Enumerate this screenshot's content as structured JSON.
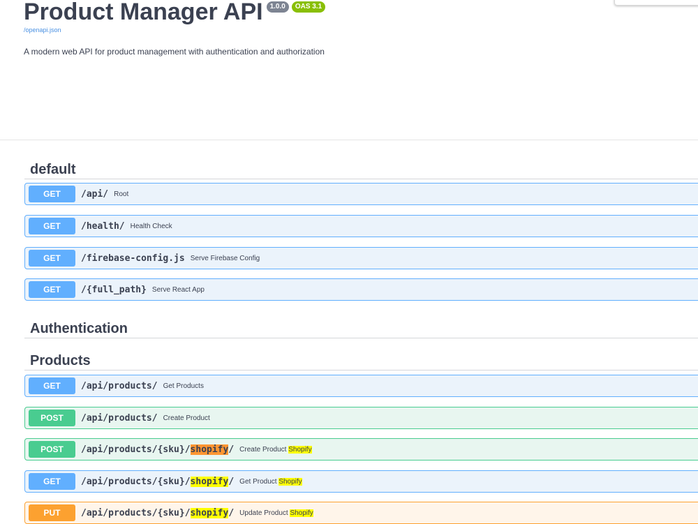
{
  "info": {
    "title": "Product Manager API",
    "version": "1.0.0",
    "oas": "OAS 3.1",
    "spec_link": "/openapi.json",
    "description": "A modern web API for product management with authentication and authorization"
  },
  "colors": {
    "get": "#61affe",
    "post": "#49cc90",
    "put": "#fca130",
    "version_badge": "#7d8492",
    "oas_badge": "#89bf04",
    "search_highlight": "#ffff00",
    "active_highlight": "#ff9632"
  },
  "sections": [
    {
      "name": "default",
      "operations": [
        {
          "method": "GET",
          "path": "/api/",
          "summary": "Root"
        },
        {
          "method": "GET",
          "path": "/health/",
          "summary": "Health Check"
        },
        {
          "method": "GET",
          "path": "/firebase-config.js",
          "summary": "Serve Firebase Config"
        },
        {
          "method": "GET",
          "path": "/{full_path}",
          "summary": "Serve React App"
        }
      ]
    },
    {
      "name": "Authentication",
      "operations": []
    },
    {
      "name": "Products",
      "operations": [
        {
          "method": "GET",
          "path": "/api/products/",
          "summary": "Get Products"
        },
        {
          "method": "POST",
          "path": "/api/products/",
          "summary": "Create Product"
        },
        {
          "method": "POST",
          "path": "/api/products/{sku}/",
          "path_highlight": "shopify",
          "path_tail": "/",
          "summary": "Create Product",
          "summary_highlight": "Shopify"
        },
        {
          "method": "GET",
          "path": "/api/products/{sku}/",
          "path_highlight": "shopify",
          "path_tail": "/",
          "summary": "Get Product",
          "summary_highlight": "Shopify"
        },
        {
          "method": "PUT",
          "path": "/api/products/{sku}/",
          "path_highlight": "shopify",
          "path_tail": "/",
          "summary": "Update Product",
          "summary_highlight": "Shopify"
        }
      ]
    }
  ]
}
